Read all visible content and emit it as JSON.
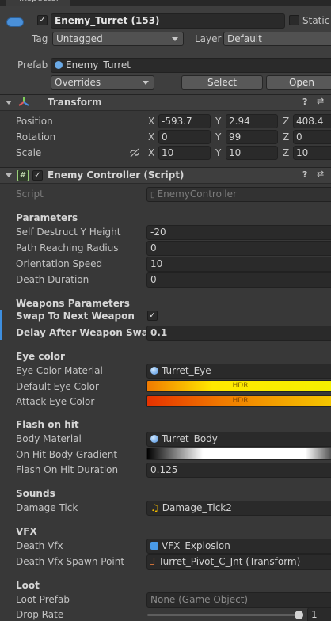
{
  "window": {
    "tab_label": "Inspector"
  },
  "object": {
    "active_checked": "✓",
    "name": "Enemy_Turret (153)",
    "static_label": "Static",
    "tag_label": "Tag",
    "tag_value": "Untagged",
    "layer_label": "Layer",
    "layer_value": "Default",
    "prefab_label": "Prefab",
    "prefab_value": "Enemy_Turret",
    "overrides_label": "Overrides",
    "select_label": "Select",
    "open_label": "Open"
  },
  "transform": {
    "title": "Transform",
    "rows": [
      {
        "label": "Position",
        "x": "-593.7",
        "y": "2.94",
        "z": "408.4"
      },
      {
        "label": "Rotation",
        "x": "0",
        "y": "99",
        "z": "0"
      },
      {
        "label": "Scale",
        "x": "10",
        "y": "10",
        "z": "10"
      }
    ],
    "axes": {
      "x": "X",
      "y": "Y",
      "z": "Z"
    }
  },
  "script_component": {
    "title": "Enemy Controller (Script)",
    "checked": "✓",
    "script_label": "Script",
    "script_value": "EnemyController",
    "sections": {
      "parameters": "Parameters",
      "weapons": "Weapons Parameters",
      "eye_color": "Eye color",
      "flash": "Flash on hit",
      "sounds": "Sounds",
      "vfx": "VFX",
      "loot": "Loot"
    },
    "fields": {
      "self_destruct_label": "Self Destruct Y Height",
      "self_destruct_value": "-20",
      "path_radius_label": "Path Reaching Radius",
      "path_radius_value": "0",
      "orientation_label": "Orientation Speed",
      "orientation_value": "10",
      "death_duration_label": "Death Duration",
      "death_duration_value": "0",
      "swap_label": "Swap To Next Weapon",
      "swap_checked": "✓",
      "delay_label": "Delay After Weapon Swap",
      "delay_value": "0.1",
      "eye_material_label": "Eye Color Material",
      "eye_material_value": "Turret_Eye",
      "default_eye_label": "Default Eye Color",
      "attack_eye_label": "Attack Eye Color",
      "hdr_label": "HDR",
      "body_material_label": "Body Material",
      "body_material_value": "Turret_Body",
      "gradient_label": "On Hit Body Gradient",
      "flash_duration_label": "Flash On Hit Duration",
      "flash_duration_value": "0.125",
      "damage_tick_label": "Damage Tick",
      "damage_tick_value": "Damage_Tick2",
      "death_vfx_label": "Death Vfx",
      "death_vfx_value": "VFX_Explosion",
      "spawn_point_label": "Death Vfx Spawn Point",
      "spawn_point_value": "Turret_Pivot_C_Jnt (Transform)",
      "loot_prefab_label": "Loot Prefab",
      "loot_prefab_value": "None (Game Object)",
      "drop_rate_label": "Drop Rate",
      "drop_rate_value": "1"
    }
  },
  "icons": {
    "help": "?",
    "settings": "⇄",
    "hash": "#"
  },
  "colors": {
    "default_eye_gradient": [
      "#f07a00",
      "#ffe800",
      "#f5ef00"
    ],
    "attack_eye_gradient": [
      "#e63200",
      "#f07a00",
      "#f5c800"
    ],
    "accent": "#3e8fe0"
  }
}
